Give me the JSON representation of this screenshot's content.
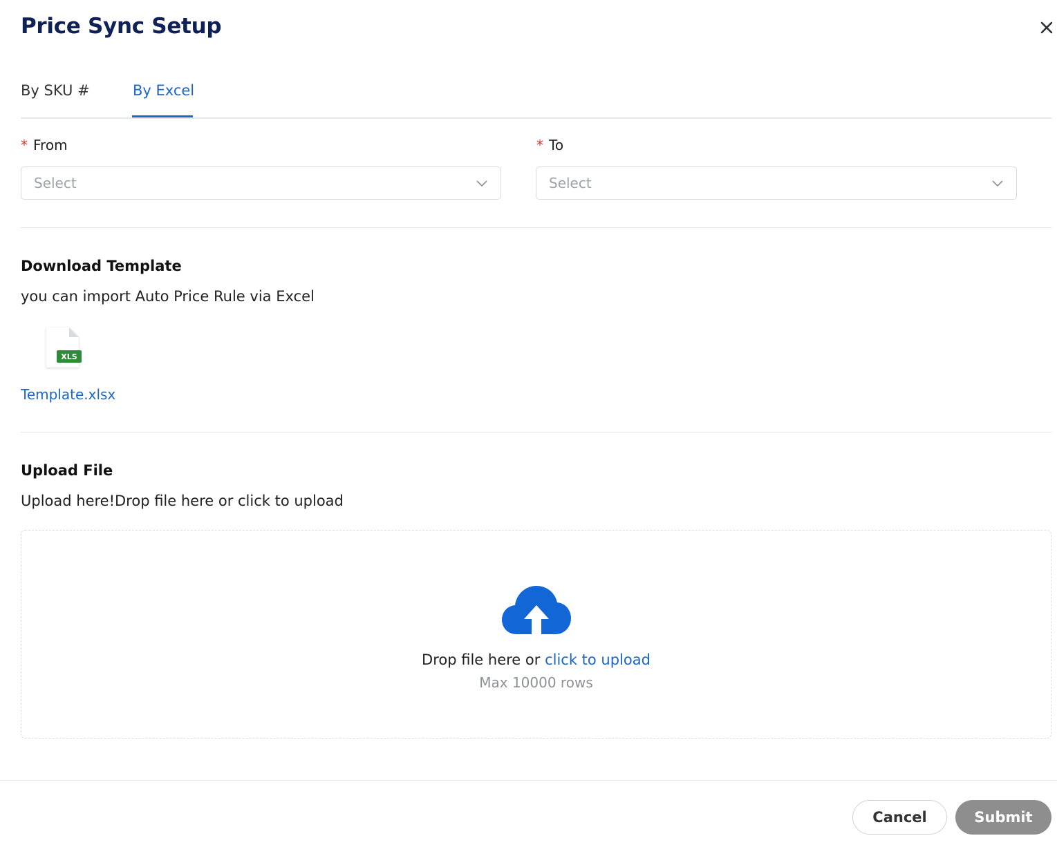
{
  "dialog": {
    "title": "Price Sync Setup"
  },
  "tabs": [
    {
      "label": "By SKU #",
      "active": false
    },
    {
      "label": "By Excel",
      "active": true
    }
  ],
  "form": {
    "from": {
      "required_mark": "*",
      "label": "From",
      "placeholder": "Select"
    },
    "to": {
      "required_mark": "*",
      "label": "To",
      "placeholder": "Select"
    }
  },
  "download": {
    "title": "Download Template",
    "description": "you can import Auto Price Rule via Excel",
    "file_badge": "XLS",
    "file_name": "Template.xlsx"
  },
  "upload": {
    "title": "Upload File",
    "description": "Upload here!Drop file here or click to upload",
    "drop_text": "Drop file here or",
    "drop_link": "click to upload",
    "limit": "Max 10000 rows"
  },
  "footer": {
    "cancel_label": "Cancel",
    "submit_label": "Submit"
  },
  "colors": {
    "accent": "#1a66c9",
    "title": "#0f2156",
    "required": "#e5322d",
    "submit_disabled": "#8e8e8e",
    "excel_green": "#2e8b3a"
  },
  "icons": {
    "close": "close-icon",
    "chevron": "chevron-down-icon",
    "file": "xls-file-icon",
    "upload": "cloud-upload-icon"
  }
}
